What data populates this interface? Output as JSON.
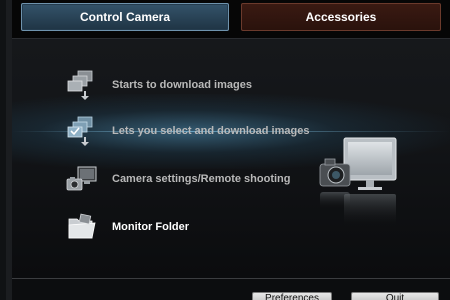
{
  "tabs": [
    {
      "label": "Control Camera",
      "active": true
    },
    {
      "label": "Accessories",
      "active": false
    }
  ],
  "menu": [
    {
      "label": "Starts to download images",
      "icon": "download-images-icon"
    },
    {
      "label": "Lets you select and download images",
      "icon": "select-download-icon"
    },
    {
      "label": "Camera settings/Remote shooting",
      "icon": "camera-settings-icon"
    },
    {
      "label": "Monitor Folder",
      "icon": "monitor-folder-icon"
    }
  ],
  "buttons": {
    "preferences": "Preferences",
    "quit": "Quit"
  },
  "colors": {
    "active_tab": "#2c4a5f",
    "inactive_tab": "#3a1a12",
    "glow": "#5aa0c8"
  }
}
